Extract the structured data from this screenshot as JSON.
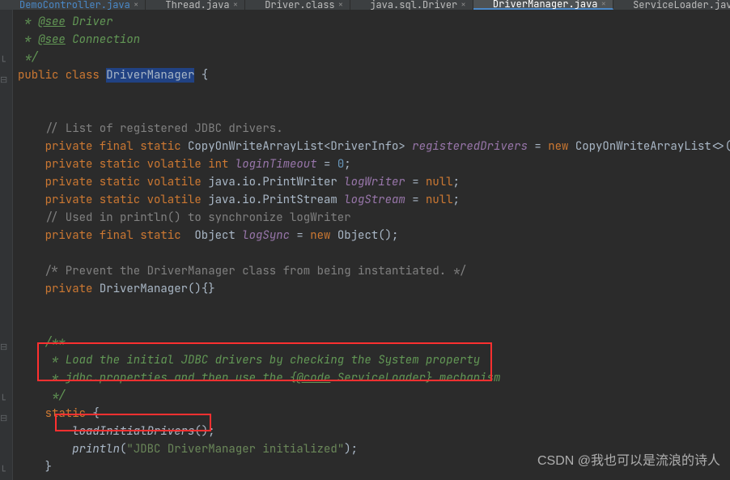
{
  "tabs": [
    {
      "label": "DemoController.java",
      "active": false,
      "modified": true
    },
    {
      "label": "Thread.java",
      "active": false
    },
    {
      "label": "Driver.class",
      "active": false
    },
    {
      "label": "java.sql.Driver",
      "active": false
    },
    {
      "label": "DriverManager.java",
      "active": true
    },
    {
      "label": "ServiceLoader.java",
      "active": false
    }
  ],
  "code": {
    "l1a": " * ",
    "l1b": "@see",
    "l1c": " Driver",
    "l2a": " * ",
    "l2b": "@see",
    "l2c": " Connection",
    "l3": " */",
    "l4a": "public class ",
    "l4b": "DriverManager",
    "l4c": " {",
    "l5": "",
    "l6": "",
    "l7": "    // List of registered JDBC drivers.",
    "l8a": "    private final static ",
    "l8b": "CopyOnWriteArrayList<DriverInfo> ",
    "l8c": "registeredDrivers",
    "l8d": " = ",
    "l8e": "new ",
    "l8f": "CopyOnWriteArrayList<>();",
    "l9a": "    private static volatile int ",
    "l9b": "loginTimeout",
    "l9c": " = ",
    "l9d": "0",
    "l9e": ";",
    "l10a": "    private static volatile ",
    "l10b": "java.io.PrintWriter ",
    "l10c": "logWriter",
    "l10d": " = ",
    "l10e": "null",
    "l10f": ";",
    "l11a": "    private static volatile ",
    "l11b": "java.io.PrintStream ",
    "l11c": "logStream",
    "l11d": " = ",
    "l11e": "null",
    "l11f": ";",
    "l12": "    // Used in println() to synchronize logWriter",
    "l13a": "    private final static  ",
    "l13b": "Object ",
    "l13c": "logSync",
    "l13d": " = ",
    "l13e": "new ",
    "l13f": "Object();",
    "l14": "",
    "l15": "    /* Prevent the DriverManager class from being instantiated. */",
    "l16a": "    private ",
    "l16b": "DriverManager",
    "l16c": "(){}",
    "l17": "",
    "l18": "",
    "l19": "    /**",
    "l20": "     * Load the initial JDBC drivers by checking the System property",
    "l21a": "     * jdbc.properties and then use the {",
    "l21b": "@code",
    "l21c": " ServiceLoader} mechanism",
    "l22": "     */",
    "l23a": "    static ",
    "l23b": "{",
    "l24a": "        ",
    "l24b": "loadInitialDrivers",
    "l24c": "();",
    "l25a": "        ",
    "l25b": "println",
    "l25c": "(",
    "l25d": "\"JDBC DriverManager initialized\"",
    "l25e": ");",
    "l26": "    }"
  },
  "watermark": "CSDN @我也可以是流浪的诗人"
}
